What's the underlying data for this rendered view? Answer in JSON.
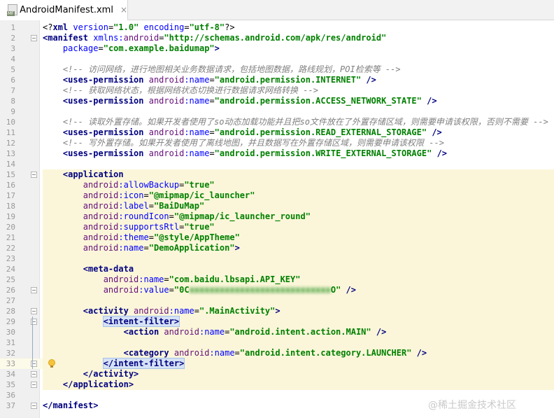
{
  "tab": {
    "title": "AndroidManifest.xml",
    "icon_badge": "MF",
    "close": "×"
  },
  "watermark": "@稀土掘金技术社区",
  "editor": {
    "caret_line": 33,
    "highlighted_lines": [
      15,
      16,
      17,
      18,
      19,
      20,
      21,
      22,
      23,
      24,
      25,
      26,
      27,
      28,
      29,
      30,
      31,
      32,
      33,
      34,
      35
    ],
    "lines": [
      {
        "n": "1",
        "tokens": [
          [
            "plain",
            "<?"
          ],
          [
            "tag",
            "xml "
          ],
          [
            "attr",
            "version"
          ],
          [
            "plain",
            "="
          ],
          [
            "val",
            "\"1.0\""
          ],
          [
            "plain",
            " "
          ],
          [
            "attr",
            "encoding"
          ],
          [
            "plain",
            "="
          ],
          [
            "val",
            "\"utf-8\""
          ],
          [
            "plain",
            "?>"
          ]
        ]
      },
      {
        "n": "2",
        "tokens": [
          [
            "tag",
            "<manifest "
          ],
          [
            "attr",
            "xmlns:"
          ],
          [
            "ns",
            "android"
          ],
          [
            "plain",
            "="
          ],
          [
            "val",
            "\"http://schemas.android.com/apk/res/android\""
          ]
        ]
      },
      {
        "n": "3",
        "tokens": [
          [
            "plain",
            "    "
          ],
          [
            "attr",
            "package"
          ],
          [
            "plain",
            "="
          ],
          [
            "val",
            "\"com.example.baidumap\""
          ],
          [
            "tag",
            ">"
          ]
        ]
      },
      {
        "n": "4",
        "tokens": []
      },
      {
        "n": "5",
        "tokens": [
          [
            "plain",
            "    "
          ],
          [
            "cmt",
            "<!-- 访问网络，进行地图相关业务数据请求，包括地图数据，路线规划，POI检索等 -->"
          ]
        ]
      },
      {
        "n": "6",
        "tokens": [
          [
            "plain",
            "    "
          ],
          [
            "tag",
            "<uses-permission "
          ],
          [
            "ns",
            "android"
          ],
          [
            "attr",
            ":name"
          ],
          [
            "plain",
            "="
          ],
          [
            "val",
            "\"android.permission.INTERNET\""
          ],
          [
            "tag",
            " />"
          ]
        ]
      },
      {
        "n": "7",
        "tokens": [
          [
            "plain",
            "    "
          ],
          [
            "cmt",
            "<!-- 获取网络状态，根据网络状态切换进行数据请求网络转换 -->"
          ]
        ]
      },
      {
        "n": "8",
        "tokens": [
          [
            "plain",
            "    "
          ],
          [
            "tag",
            "<uses-permission "
          ],
          [
            "ns",
            "android"
          ],
          [
            "attr",
            ":name"
          ],
          [
            "plain",
            "="
          ],
          [
            "val",
            "\"android.permission.ACCESS_NETWORK_STATE\""
          ],
          [
            "tag",
            " />"
          ]
        ]
      },
      {
        "n": "9",
        "tokens": []
      },
      {
        "n": "10",
        "tokens": [
          [
            "plain",
            "    "
          ],
          [
            "cmt",
            "<!-- 读取外置存储。如果开发者使用了so动态加载功能并且把so文件放在了外置存储区域，则需要申请该权限，否则不需要 -->"
          ]
        ]
      },
      {
        "n": "11",
        "tokens": [
          [
            "plain",
            "    "
          ],
          [
            "tag",
            "<uses-permission "
          ],
          [
            "ns",
            "android"
          ],
          [
            "attr",
            ":name"
          ],
          [
            "plain",
            "="
          ],
          [
            "val",
            "\"android.permission.READ_EXTERNAL_STORAGE\""
          ],
          [
            "tag",
            " />"
          ]
        ]
      },
      {
        "n": "12",
        "tokens": [
          [
            "plain",
            "    "
          ],
          [
            "cmt",
            "<!-- 写外置存储。如果开发者使用了离线地图，并且数据写在外置存储区域，则需要申请该权限 -->"
          ]
        ]
      },
      {
        "n": "13",
        "tokens": [
          [
            "plain",
            "    "
          ],
          [
            "tag",
            "<uses-permission "
          ],
          [
            "ns",
            "android"
          ],
          [
            "attr",
            ":name"
          ],
          [
            "plain",
            "="
          ],
          [
            "val",
            "\"android.permission.WRITE_EXTERNAL_STORAGE\""
          ],
          [
            "tag",
            " />"
          ]
        ]
      },
      {
        "n": "14",
        "tokens": []
      },
      {
        "n": "15",
        "tokens": [
          [
            "plain",
            "    "
          ],
          [
            "tag",
            "<application"
          ]
        ]
      },
      {
        "n": "16",
        "tokens": [
          [
            "plain",
            "        "
          ],
          [
            "ns",
            "android"
          ],
          [
            "attr",
            ":allowBackup"
          ],
          [
            "plain",
            "="
          ],
          [
            "val",
            "\"true\""
          ]
        ]
      },
      {
        "n": "17",
        "tokens": [
          [
            "plain",
            "        "
          ],
          [
            "ns",
            "android"
          ],
          [
            "attr",
            ":icon"
          ],
          [
            "plain",
            "="
          ],
          [
            "val",
            "\"@mipmap/ic_launcher\""
          ]
        ]
      },
      {
        "n": "18",
        "tokens": [
          [
            "plain",
            "        "
          ],
          [
            "ns",
            "android"
          ],
          [
            "attr",
            ":label"
          ],
          [
            "plain",
            "="
          ],
          [
            "val",
            "\"BaiDuMap\""
          ]
        ]
      },
      {
        "n": "19",
        "tokens": [
          [
            "plain",
            "        "
          ],
          [
            "ns",
            "android"
          ],
          [
            "attr",
            ":roundIcon"
          ],
          [
            "plain",
            "="
          ],
          [
            "val",
            "\"@mipmap/ic_launcher_round\""
          ]
        ]
      },
      {
        "n": "20",
        "tokens": [
          [
            "plain",
            "        "
          ],
          [
            "ns",
            "android"
          ],
          [
            "attr",
            ":supportsRtl"
          ],
          [
            "plain",
            "="
          ],
          [
            "val",
            "\"true\""
          ]
        ]
      },
      {
        "n": "21",
        "tokens": [
          [
            "plain",
            "        "
          ],
          [
            "ns",
            "android"
          ],
          [
            "attr",
            ":theme"
          ],
          [
            "plain",
            "="
          ],
          [
            "val",
            "\"@style/AppTheme\""
          ]
        ]
      },
      {
        "n": "22",
        "tokens": [
          [
            "plain",
            "        "
          ],
          [
            "ns",
            "android"
          ],
          [
            "attr",
            ":name"
          ],
          [
            "plain",
            "="
          ],
          [
            "val",
            "\"DemoApplication\""
          ],
          [
            "tag",
            ">"
          ]
        ]
      },
      {
        "n": "23",
        "tokens": []
      },
      {
        "n": "24",
        "tokens": [
          [
            "plain",
            "        "
          ],
          [
            "tag",
            "<meta-data"
          ]
        ]
      },
      {
        "n": "25",
        "tokens": [
          [
            "plain",
            "            "
          ],
          [
            "ns",
            "android"
          ],
          [
            "attr",
            ":name"
          ],
          [
            "plain",
            "="
          ],
          [
            "val",
            "\"com.baidu.lbsapi.API_KEY\""
          ]
        ]
      },
      {
        "n": "26",
        "tokens": [
          [
            "plain",
            "            "
          ],
          [
            "ns",
            "android"
          ],
          [
            "attr",
            ":value"
          ],
          [
            "plain",
            "="
          ],
          [
            "val",
            "\"0C"
          ],
          [
            "blur",
            "xxxxxxxxxxxxxxxxxxxxxxxxxxxx"
          ],
          [
            "val",
            "O\""
          ],
          [
            "tag",
            " />"
          ]
        ]
      },
      {
        "n": "27",
        "tokens": []
      },
      {
        "n": "28",
        "tokens": [
          [
            "plain",
            "        "
          ],
          [
            "tag",
            "<activity "
          ],
          [
            "ns",
            "android"
          ],
          [
            "attr",
            ":name"
          ],
          [
            "plain",
            "="
          ],
          [
            "val",
            "\".MainActivity\""
          ],
          [
            "tag",
            ">"
          ]
        ]
      },
      {
        "n": "29",
        "tokens": [
          [
            "plain",
            "            "
          ],
          [
            "tag",
            "<intent-filter>"
          ]
        ]
      },
      {
        "n": "30",
        "tokens": [
          [
            "plain",
            "                "
          ],
          [
            "tag",
            "<action "
          ],
          [
            "ns",
            "android"
          ],
          [
            "attr",
            ":name"
          ],
          [
            "plain",
            "="
          ],
          [
            "val",
            "\"android.intent.action.MAIN\""
          ],
          [
            "tag",
            " />"
          ]
        ]
      },
      {
        "n": "31",
        "tokens": []
      },
      {
        "n": "32",
        "tokens": [
          [
            "plain",
            "                "
          ],
          [
            "tag",
            "<category "
          ],
          [
            "ns",
            "android"
          ],
          [
            "attr",
            ":name"
          ],
          [
            "plain",
            "="
          ],
          [
            "val",
            "\"android.intent.category.LAUNCHER\""
          ],
          [
            "tag",
            " />"
          ]
        ]
      },
      {
        "n": "33",
        "tokens": [
          [
            "plain",
            "            "
          ],
          [
            "tag",
            "</intent-filter>"
          ]
        ]
      },
      {
        "n": "34",
        "tokens": [
          [
            "plain",
            "        "
          ],
          [
            "tag",
            "</activity>"
          ]
        ]
      },
      {
        "n": "35",
        "tokens": [
          [
            "plain",
            "    "
          ],
          [
            "tag",
            "</application>"
          ]
        ]
      },
      {
        "n": "36",
        "tokens": []
      },
      {
        "n": "37",
        "tokens": [
          [
            "tag",
            "</manifest>"
          ]
        ]
      }
    ]
  }
}
